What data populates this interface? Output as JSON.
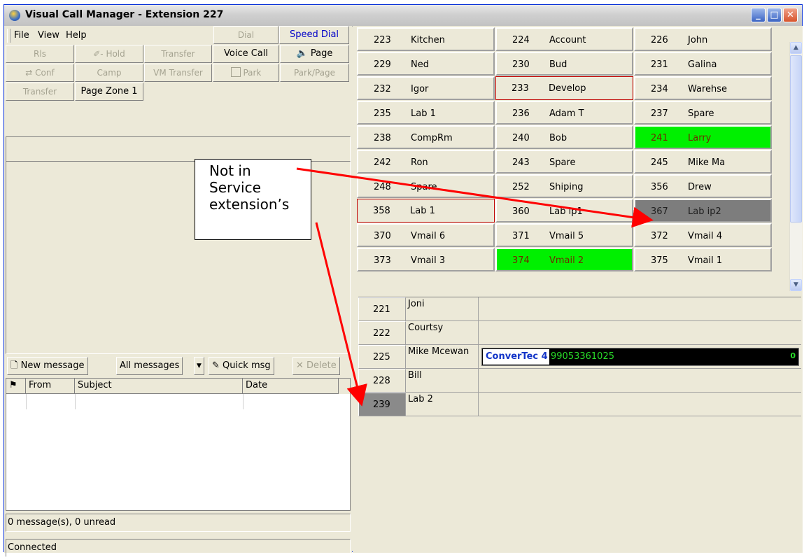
{
  "window": {
    "title": "Visual Call Manager - Extension 227"
  },
  "menu": {
    "file": "File",
    "view": "View",
    "help": "Help"
  },
  "toolbar": {
    "dial": "Dial",
    "speed_dial": "Speed Dial",
    "rls": "Rls",
    "hold": "- Hold",
    "transfer": "Transfer",
    "voice_call": "Voice Call",
    "page": "Page",
    "conf": "Conf",
    "camp": "Camp",
    "vm_transfer": "VM Transfer",
    "park": "Park",
    "park_page": "Park/Page",
    "transfer2": "Transfer",
    "page_zone": "Page Zone 1"
  },
  "messages": {
    "new_message": "New message",
    "all_messages": "All messages",
    "quick_msg": "Quick msg",
    "delete": "Delete",
    "columns": [
      "From",
      "Subject",
      "Date"
    ],
    "status": "0 message(s), 0 unread"
  },
  "statusbar": {
    "text": "Connected"
  },
  "extensions": [
    {
      "num": "223",
      "name": "Kitchen"
    },
    {
      "num": "224",
      "name": "Account"
    },
    {
      "num": "226",
      "name": "John"
    },
    {
      "num": "229",
      "name": "Ned"
    },
    {
      "num": "230",
      "name": "Bud"
    },
    {
      "num": "231",
      "name": "Galina"
    },
    {
      "num": "232",
      "name": "Igor"
    },
    {
      "num": "233",
      "name": "Develop"
    },
    {
      "num": "234",
      "name": "Warehse"
    },
    {
      "num": "235",
      "name": "Lab 1"
    },
    {
      "num": "236",
      "name": "Adam T"
    },
    {
      "num": "237",
      "name": "Spare"
    },
    {
      "num": "238",
      "name": "CompRm"
    },
    {
      "num": "240",
      "name": "Bob"
    },
    {
      "num": "241",
      "name": "Larry"
    },
    {
      "num": "242",
      "name": "Ron"
    },
    {
      "num": "243",
      "name": "Spare"
    },
    {
      "num": "245",
      "name": "Mike Ma"
    },
    {
      "num": "248",
      "name": "Spare"
    },
    {
      "num": "252",
      "name": "Shiping"
    },
    {
      "num": "356",
      "name": "Drew"
    },
    {
      "num": "358",
      "name": "Lab 1"
    },
    {
      "num": "360",
      "name": "Lab ip1"
    },
    {
      "num": "367",
      "name": "Lab ip2"
    },
    {
      "num": "370",
      "name": "Vmail 6"
    },
    {
      "num": "371",
      "name": "Vmail 5"
    },
    {
      "num": "372",
      "name": "Vmail 4"
    },
    {
      "num": "373",
      "name": "Vmail 3"
    },
    {
      "num": "374",
      "name": "Vmail 2"
    },
    {
      "num": "375",
      "name": "Vmail 1"
    }
  ],
  "states": {
    "red_outline": [
      "233",
      "358"
    ],
    "green": [
      "241",
      "374"
    ],
    "gray": [
      "367"
    ]
  },
  "lines": [
    {
      "num": "221",
      "name": "Joni"
    },
    {
      "num": "222",
      "name": "Courtsy"
    },
    {
      "num": "225",
      "name": "Mike Mcewan",
      "call_name": "ConverTec 4",
      "call_number": "99053361025",
      "indicator": "0"
    },
    {
      "num": "228",
      "name": "Bill"
    },
    {
      "num": "239",
      "name": "Lab 2",
      "gray": true
    }
  ],
  "annotation": {
    "line1": "Not in",
    "line2": "Service",
    "line3": "extension’s"
  },
  "colors": {
    "busy_green": "#00f000",
    "out_of_service": "#7d7d7d",
    "ringing_red": "#c00000",
    "arrow": "#ff0000"
  }
}
